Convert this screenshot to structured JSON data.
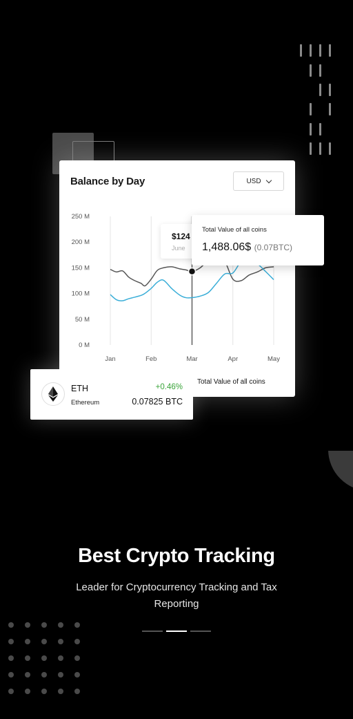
{
  "card": {
    "title": "Balance by Day",
    "currency_label": "USD",
    "legend_label": "Total Value of all coins"
  },
  "tooltip_small": {
    "value": "$124",
    "month": "June"
  },
  "tooltip_big": {
    "label": "Total Value of all coins",
    "value": "1,488.06$",
    "sub": "(0.07BTC)"
  },
  "eth": {
    "symbol": "ETH",
    "name": "Ethereum",
    "change": "+0.46%",
    "value": "0.07825 BTC",
    "change_color": "#3aa43a"
  },
  "headline": "Best Crypto Tracking",
  "subline": "Leader for Cryptocurrency Tracking and Tax Reporting",
  "pager": {
    "pages": 3,
    "active": 1
  },
  "chart_data": {
    "type": "line",
    "title": "Balance by Day",
    "categories": [
      "Jan",
      "Feb",
      "Mar",
      "Apr",
      "May"
    ],
    "y_ticks": [
      "250 M",
      "200 M",
      "150 M",
      "100 M",
      "50 M",
      "0 M"
    ],
    "ylim": [
      0,
      250
    ],
    "highlight_category": "Mar",
    "series": [
      {
        "color": "#555555",
        "x": [
          0,
          0.15,
          0.3,
          0.45,
          0.6,
          0.75,
          0.85,
          1.0,
          1.15,
          1.3,
          1.5,
          1.7,
          1.85,
          2.0,
          2.2,
          2.4,
          2.6,
          2.8,
          3.0,
          3.2,
          3.4,
          3.6,
          3.8,
          4.0
        ],
        "values": [
          147,
          142,
          144,
          132,
          125,
          120,
          115,
          128,
          145,
          150,
          152,
          148,
          146,
          143,
          150,
          165,
          172,
          163,
          128,
          125,
          136,
          142,
          150,
          152
        ]
      },
      {
        "color": "#3aaed8",
        "x": [
          0,
          0.15,
          0.3,
          0.45,
          0.6,
          0.8,
          1.0,
          1.15,
          1.3,
          1.5,
          1.7,
          1.85,
          2.0,
          2.2,
          2.4,
          2.6,
          2.8,
          3.0,
          3.2,
          3.4,
          3.6,
          3.8,
          4.0
        ],
        "values": [
          98,
          88,
          86,
          90,
          93,
          98,
          110,
          122,
          126,
          110,
          97,
          92,
          92,
          95,
          102,
          120,
          138,
          140,
          162,
          168,
          158,
          143,
          127
        ]
      }
    ]
  }
}
